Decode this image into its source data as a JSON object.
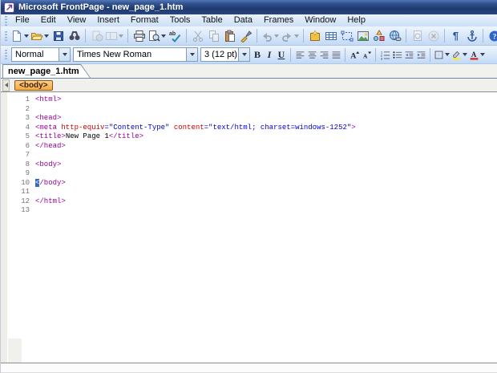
{
  "window": {
    "title": "Microsoft FrontPage - new_page_1.htm"
  },
  "menu_bar": {
    "items": [
      "File",
      "Edit",
      "View",
      "Insert",
      "Format",
      "Tools",
      "Table",
      "Data",
      "Frames",
      "Window",
      "Help"
    ]
  },
  "standard_toolbar": {
    "buttons": [
      {
        "name": "new-page",
        "dropdown": true,
        "enabled": true
      },
      {
        "name": "open",
        "dropdown": true,
        "enabled": true
      },
      {
        "name": "save",
        "enabled": true
      },
      {
        "name": "find",
        "enabled": true
      },
      {
        "sep": true
      },
      {
        "name": "publish-site",
        "enabled": false
      },
      {
        "name": "toggle-pane",
        "dropdown": true,
        "enabled": false
      },
      {
        "sep": true
      },
      {
        "name": "print",
        "enabled": true
      },
      {
        "name": "print-preview",
        "dropdown": true,
        "enabled": true
      },
      {
        "name": "spelling",
        "enabled": true
      },
      {
        "sep": true
      },
      {
        "name": "cut",
        "enabled": false
      },
      {
        "name": "copy",
        "enabled": false
      },
      {
        "name": "paste",
        "enabled": true
      },
      {
        "name": "format-painter",
        "enabled": true
      },
      {
        "sep": true
      },
      {
        "name": "undo",
        "dropdown": true,
        "enabled": false
      },
      {
        "name": "redo",
        "dropdown": true,
        "enabled": false
      },
      {
        "sep": true
      },
      {
        "name": "web-component",
        "enabled": true
      },
      {
        "name": "insert-table",
        "enabled": true
      },
      {
        "name": "insert-layer",
        "enabled": true
      },
      {
        "name": "insert-picture",
        "enabled": true
      },
      {
        "name": "drawing",
        "enabled": true
      },
      {
        "name": "insert-hyperlink",
        "enabled": true
      },
      {
        "sep": true
      },
      {
        "name": "refresh",
        "enabled": false
      },
      {
        "name": "stop",
        "enabled": false
      },
      {
        "sep": true
      },
      {
        "name": "show-all",
        "glyph": "¶",
        "enabled": true
      },
      {
        "name": "show-layer-anchors",
        "enabled": true
      },
      {
        "sep": true
      },
      {
        "name": "help",
        "enabled": true
      },
      {
        "name": "toolbar-options",
        "enabled": true
      }
    ]
  },
  "formatting_toolbar": {
    "style": {
      "value": "Normal"
    },
    "font": {
      "value": "Times New Roman"
    },
    "size": {
      "value": "3 (12 pt)"
    },
    "buttons": [
      {
        "name": "bold",
        "glyph": "B",
        "enabled": true
      },
      {
        "name": "italic",
        "glyph": "I",
        "enabled": true
      },
      {
        "name": "underline",
        "glyph": "U",
        "enabled": true
      },
      {
        "sep": true
      },
      {
        "name": "align-left",
        "enabled": true
      },
      {
        "name": "align-center",
        "enabled": true
      },
      {
        "name": "align-right",
        "enabled": true
      },
      {
        "name": "justify",
        "enabled": true
      },
      {
        "sep": true
      },
      {
        "name": "increase-font-size",
        "enabled": true
      },
      {
        "name": "decrease-font-size",
        "enabled": true
      },
      {
        "sep": true
      },
      {
        "name": "numbering",
        "enabled": true
      },
      {
        "name": "bullets",
        "enabled": true
      },
      {
        "name": "decrease-indent",
        "enabled": true
      },
      {
        "name": "increase-indent",
        "enabled": true
      },
      {
        "sep": true
      },
      {
        "name": "outside-borders",
        "dropdown": true,
        "enabled": true
      },
      {
        "name": "highlight",
        "dropdown": true,
        "enabled": true
      },
      {
        "name": "font-color",
        "dropdown": true,
        "enabled": true
      }
    ]
  },
  "document_tabs": {
    "tabs": [
      {
        "label": "new_page_1.htm",
        "active": true
      }
    ]
  },
  "quick_tag_bar": {
    "tags": [
      {
        "label": "<body>"
      }
    ]
  },
  "code_editor": {
    "lines": [
      {
        "n": "1",
        "segments": [
          {
            "text": "<html>",
            "kind": "tag"
          }
        ]
      },
      {
        "n": "2",
        "segments": []
      },
      {
        "n": "3",
        "segments": [
          {
            "text": "<head>",
            "kind": "tag"
          }
        ]
      },
      {
        "n": "4",
        "segments": [
          {
            "text": "<meta ",
            "kind": "tag"
          },
          {
            "text": "http-equiv",
            "kind": "attr"
          },
          {
            "text": "=\"Content-Type\"",
            "kind": "val"
          },
          {
            "text": " ",
            "kind": "text"
          },
          {
            "text": "content",
            "kind": "attr"
          },
          {
            "text": "=\"text/html; charset=windows-1252\"",
            "kind": "val"
          },
          {
            "text": ">",
            "kind": "tag"
          }
        ]
      },
      {
        "n": "5",
        "segments": [
          {
            "text": "<title>",
            "kind": "tag"
          },
          {
            "text": "New Page 1",
            "kind": "text"
          },
          {
            "text": "</title>",
            "kind": "tag"
          }
        ]
      },
      {
        "n": "6",
        "segments": [
          {
            "text": "</head>",
            "kind": "tag"
          }
        ]
      },
      {
        "n": "7",
        "segments": []
      },
      {
        "n": "8",
        "segments": [
          {
            "text": "<body>",
            "kind": "tag"
          }
        ]
      },
      {
        "n": "9",
        "segments": []
      },
      {
        "n": "10",
        "segments": [
          {
            "text": "<",
            "kind": "tag",
            "selected": true
          },
          {
            "text": "/body>",
            "kind": "tag"
          }
        ]
      },
      {
        "n": "11",
        "segments": []
      },
      {
        "n": "12",
        "segments": [
          {
            "text": "</html>",
            "kind": "tag"
          }
        ]
      },
      {
        "n": "13",
        "segments": []
      }
    ]
  },
  "colors": {
    "tag_purple": "#990098",
    "attribute_red": "#CC0000",
    "value_blue": "#0000D4",
    "text_black": "#000000",
    "line_number_gray": "#747474",
    "selection_blue": "#316AC5",
    "quick_tag_orange": "#F5A93D",
    "titlebar_navy": "#1F3A6E"
  }
}
